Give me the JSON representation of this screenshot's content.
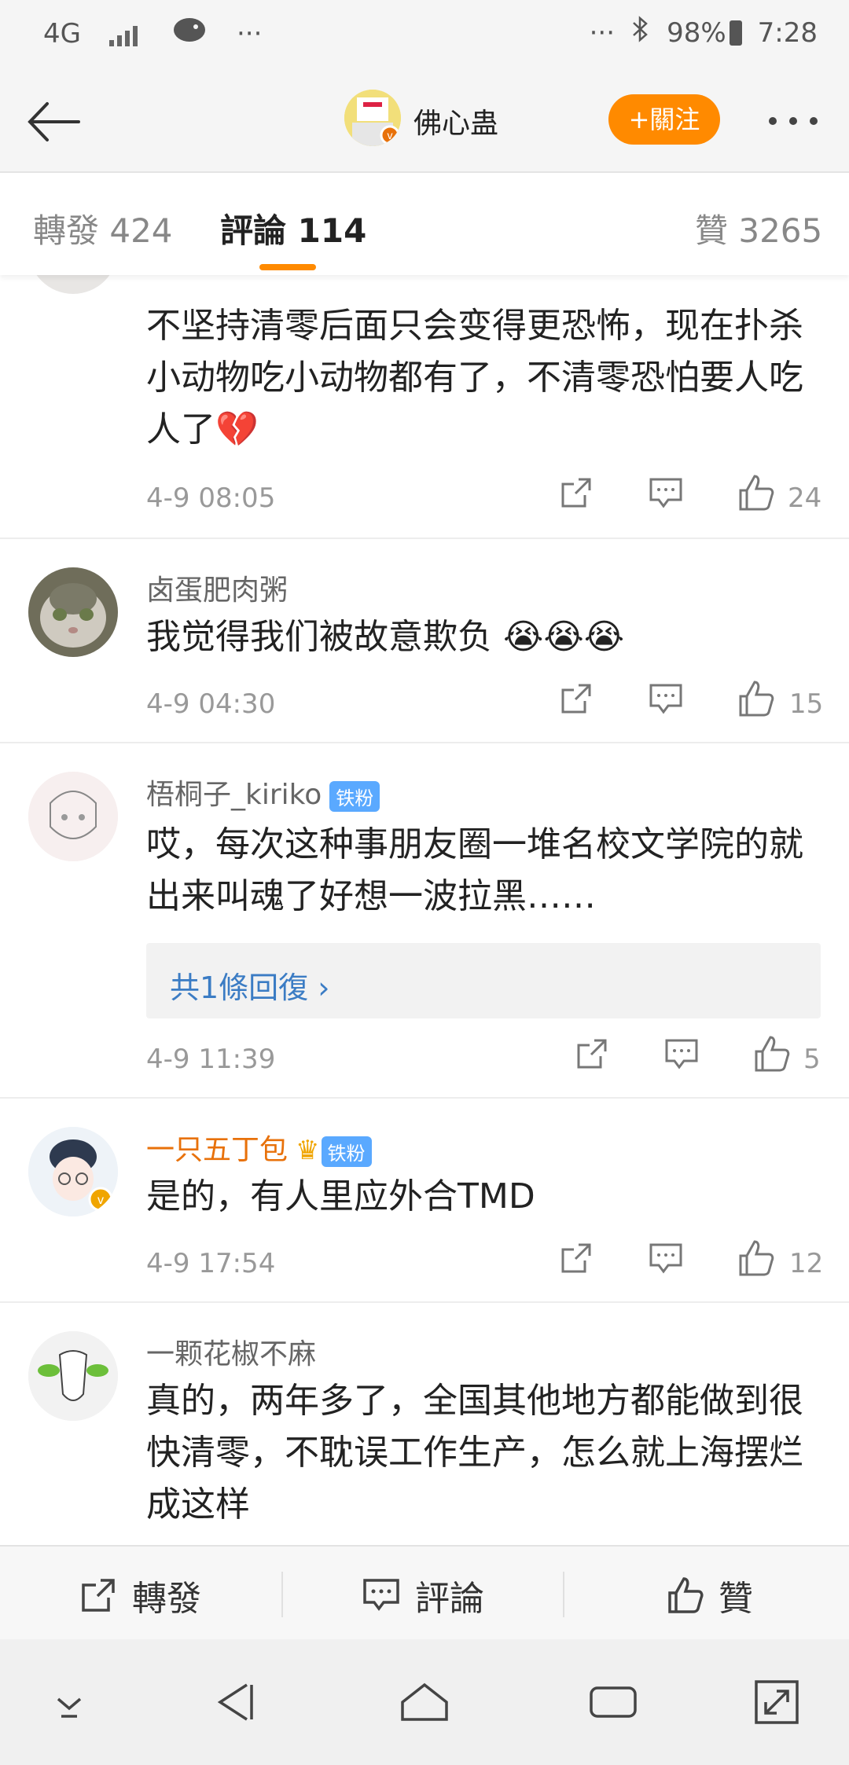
{
  "status_bar": {
    "network": "4G",
    "dots": "···",
    "battery": "98%",
    "time": "7:28"
  },
  "nav": {
    "user_name": "佛心蛊",
    "follow_label": "+關注"
  },
  "tabs": [
    {
      "label": "轉發 424"
    },
    {
      "label": "評論 114"
    },
    {
      "label": "贊 3265"
    }
  ],
  "comments": [
    {
      "text": "不坚持清零后面只会变得更恐怖，现在扑杀小动物吃小动物都有了，不清零恐怕要人吃人了💔",
      "time": "4-9 08:05",
      "likes": "24"
    },
    {
      "name": "卤蛋肥肉粥",
      "text": "我觉得我们被故意欺负 😭😭😭",
      "time": "4-9 04:30",
      "likes": "15"
    },
    {
      "name": "梧桐子_kiriko",
      "badge": "铁粉",
      "text": "哎，每次这种事朋友圈一堆名校文学院的就出来叫魂了好想一波拉黑……",
      "reply": "共1條回復 ›",
      "time": "4-9 11:39",
      "likes": "5"
    },
    {
      "name": "一只五丁包",
      "badge": "铁粉",
      "text": "是的，有人里应外合TMD",
      "time": "4-9 17:54",
      "likes": "12"
    },
    {
      "name": "一颗花椒不麻",
      "text": "真的，两年多了，全国其他地方都能做到很快清零，不耽误工作生产，怎么就上海摆烂成这样"
    }
  ],
  "action_bar": {
    "repost": "轉發",
    "comment": "評論",
    "like": "贊"
  },
  "colors": {
    "accent": "#ff8a00",
    "link": "#3b7cc4",
    "badge": "#5aa9ff"
  }
}
